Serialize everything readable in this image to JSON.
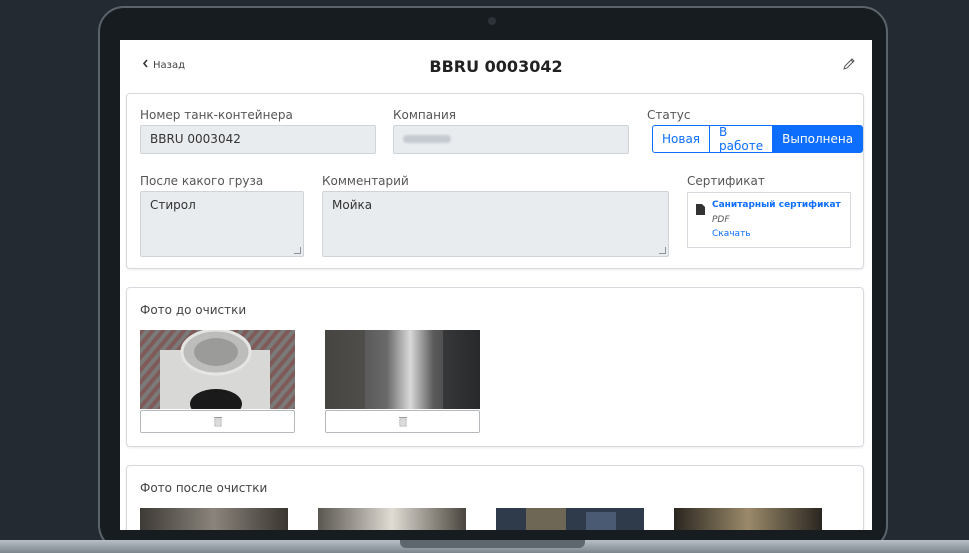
{
  "header": {
    "back_label": "Назад",
    "title": "BBRU 0003042"
  },
  "form": {
    "container_label": "Номер танк-контейнера",
    "container_value": "BBRU 0003042",
    "company_label": "Компания",
    "status_label": "Статус",
    "status_options": [
      "Новая",
      "В работе",
      "Выполнена"
    ],
    "status_selected": "Выполнена",
    "cargo_label": "После какого груза",
    "cargo_value": "Стирол",
    "comment_label": "Комментарий",
    "comment_value": "Мойка",
    "certificate_label": "Сертификат",
    "certificate": {
      "name": "Санитарный сертификат",
      "type": "PDF",
      "download_label": "Скачать"
    }
  },
  "photos_before": {
    "title": "Фото до очистки"
  },
  "photos_after": {
    "title": "Фото после очистки"
  },
  "colors": {
    "accent": "#0d6efd",
    "field_bg": "#e9ecef",
    "frame": "#171c21"
  },
  "icons": [
    "chevron-left-icon",
    "pencil-icon",
    "document-icon",
    "trash-icon"
  ]
}
